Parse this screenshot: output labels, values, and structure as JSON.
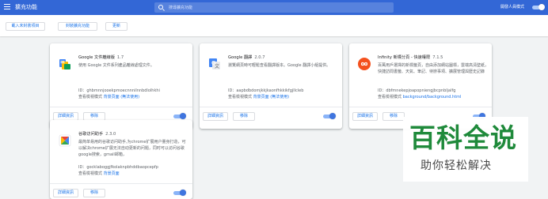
{
  "topbar": {
    "title": "擴充功能",
    "search_placeholder": "搜尋擴充功能",
    "devmode_label": "開發人員模式",
    "devmode_on": true
  },
  "subbar": {
    "load_unpacked": "載入未封裝項目",
    "pack_extension": "封裝擴充功能",
    "update": "更新"
  },
  "card_labels": {
    "details": "詳細資訊",
    "remove": "移除",
    "id_prefix": "ID：",
    "views_prefix": "查看檢視模式"
  },
  "extensions": [
    {
      "name": "Google 文件離線版",
      "version": "1.7",
      "description": "使用 Google 文件系列產品離線處理文件。",
      "id": "ghbmnnjooekpmoecnnnilnnbdlolhkhi",
      "views_link": "背景頁面 (無法使用)",
      "enabled": true,
      "icon": "google-docs-offline-icon"
    },
    {
      "name": "Google 翻譯",
      "version": "2.0.7",
      "description": "瀏覽網頁時可輕鬆查看翻譯版本。Google 翻譯小組提供。",
      "id": "aapbdbdomjkkjkaonfhkkikfgjllcleb",
      "views_link": "背景頁面 (無法使用)",
      "enabled": true,
      "icon": "google-translate-icon"
    },
    {
      "name": "Infinity 新標分頁 - 快速權限",
      "version": "7.1.5",
      "description": "百萬用戶選擇的新標籤頁，自由添加網站圖標，雲端高清壁紙，快捷訪問書籤、天氣、筆記、待辦事項、擴展管理與歷史記錄",
      "id": "dbfmnekepjoapopniengjbcpnbljalfg",
      "views_link": "background/background.html",
      "enabled": true,
      "icon": "infinity-icon"
    },
    {
      "name": "谷歌访问助手",
      "version": "2.3.0",
      "description": "最简单易用的谷歌访问助手,为chrome扩展用户量身打造，可以解决chrome扩展无法自动更新的问题，同时可以访问谷歌google搜索，gmail邮箱，",
      "id": "gocklaboggjfkolaknpbhddbaopcepfp",
      "views_link": "背景頁面",
      "enabled": true,
      "icon": "google-access-helper-icon"
    }
  ],
  "watermark": {
    "title": "百科全说",
    "subtitle": "助你轻松解决"
  },
  "colors": {
    "topbar": "#3367d6",
    "accent": "#1a73e8",
    "watermark_green": "#1f8a3b"
  }
}
